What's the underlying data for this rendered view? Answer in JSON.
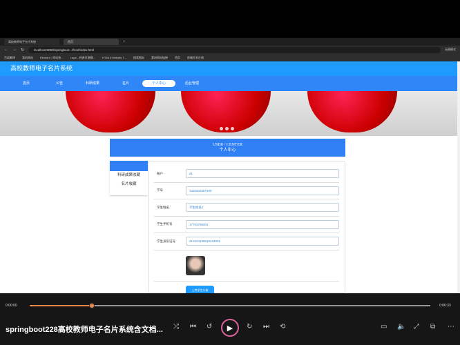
{
  "browser": {
    "tabs": [
      "高校教师电子名片系统",
      "首页"
    ],
    "url": "localhost:8080/springboot.../front/index.html",
    "bookmarks": [
      "百度翻译",
      "我的网站",
      "Element - 网站快...",
      "Layui - 经典开源模...",
      "HTML5 Website T...",
      "搜索图标",
      "素材网站链接",
      "首页",
      "前端开发在线"
    ],
    "profile": "无痕模式"
  },
  "site": {
    "title": "高校教师电子名片系统",
    "nav": [
      "首页",
      "公告",
      "科研成果",
      "名片",
      "个人中心",
      "后台管理"
    ],
    "active_nav": 4
  },
  "center": {
    "title_en": "USER / CENTER",
    "title_cn": "个人中心",
    "side": [
      "科研成果收藏",
      "名片收藏"
    ],
    "fields": [
      {
        "label": "账户",
        "value": "a1"
      },
      {
        "label": "学号",
        "value": "1020202907400"
      },
      {
        "label": "学生姓名",
        "value": "学生姓名1"
      },
      {
        "label": "学生手机号",
        "value": "17703786001"
      },
      {
        "label": "学生身份证号",
        "value": "410224199610232001"
      }
    ],
    "upload": "上传学生头像"
  },
  "player": {
    "current": "0:00:00",
    "duration": "0:06:33",
    "progress": 0.155,
    "title": "springboot228高校教师电子名片系统含文档..."
  }
}
